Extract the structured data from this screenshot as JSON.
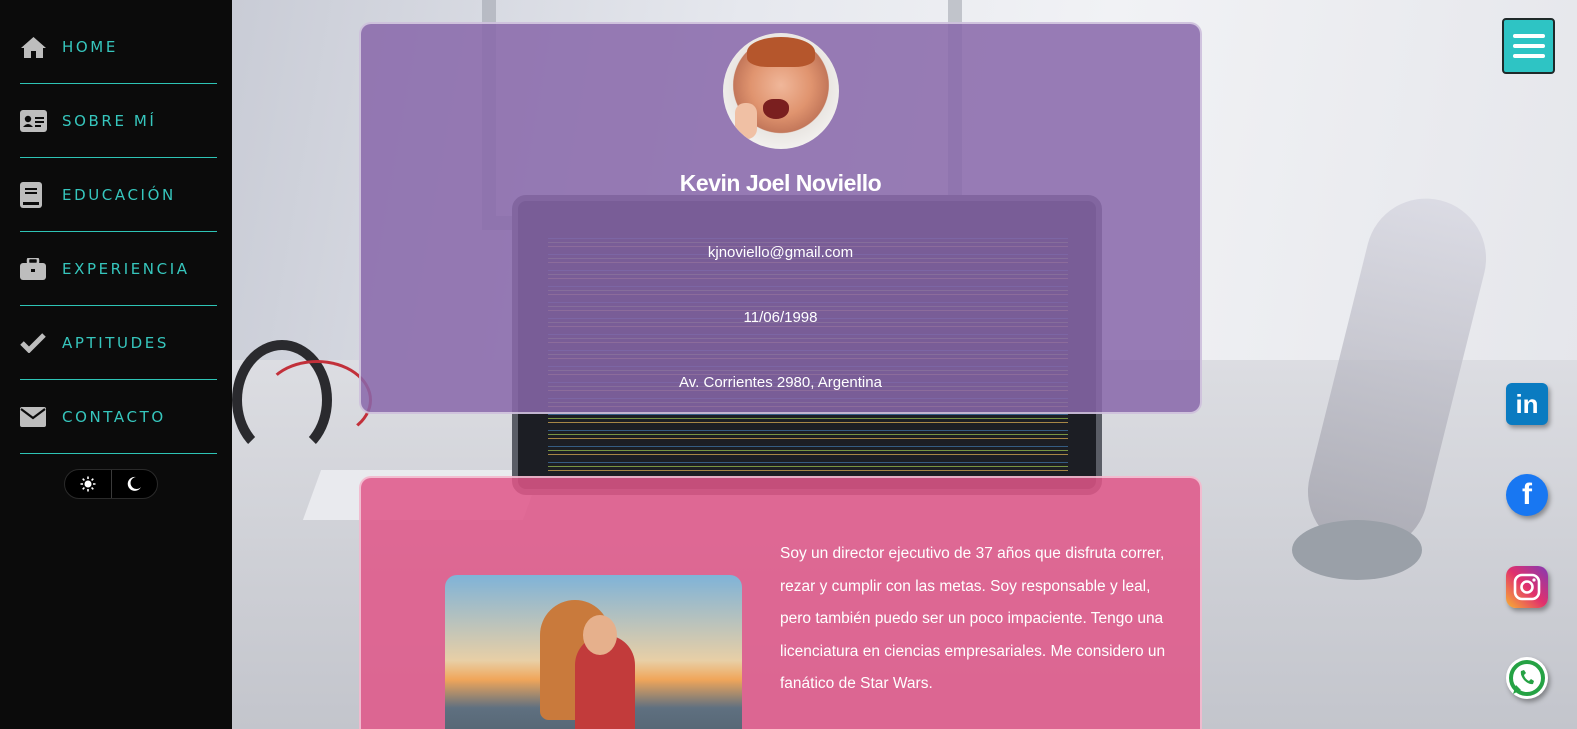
{
  "sidebar": {
    "items": [
      {
        "label": "HOME",
        "icon": "home-icon"
      },
      {
        "label": "SOBRE MÍ",
        "icon": "id-card-icon"
      },
      {
        "label": "EDUCACIÓN",
        "icon": "book-icon"
      },
      {
        "label": "EXPERIENCIA",
        "icon": "briefcase-icon"
      },
      {
        "label": "APTITUDES",
        "icon": "check-icon"
      },
      {
        "label": "CONTACTO",
        "icon": "envelope-icon"
      }
    ],
    "theme_toggle": {
      "light_icon": "sun-icon",
      "dark_icon": "moon-icon"
    }
  },
  "profile": {
    "name": "Kevin Joel Noviello",
    "email": "kjnoviello@gmail.com",
    "birthdate": "11/06/1998",
    "address": "Av. Corrientes 2980, Argentina"
  },
  "about": {
    "text": "Soy un director ejecutivo de 37 años que disfruta correr, rezar y cumplir con las metas. Soy responsable y leal, pero también puedo ser un poco impaciente. Tengo una licenciatura en ciencias empresariales. Me considero un fanático de Star Wars."
  },
  "social": {
    "linkedin_text": "in",
    "facebook_text": "f"
  },
  "colors": {
    "accent": "#2ec4b6",
    "profile_card": "#8868aa",
    "about_card": "#e05688",
    "sidebar_bg": "#0b0b0b"
  }
}
